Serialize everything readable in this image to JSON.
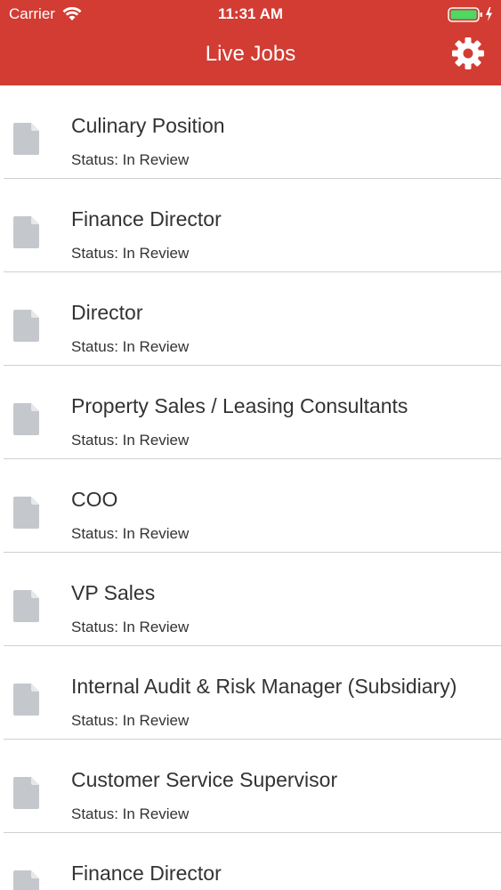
{
  "status_bar": {
    "carrier": "Carrier",
    "time": "11:31 AM",
    "battery_color": "#4cd964"
  },
  "nav": {
    "title": "Live Jobs",
    "settings_icon": "gear-icon",
    "background_color": "#d23c33"
  },
  "jobs": [
    {
      "title": "Culinary Position",
      "status": "Status: In Review"
    },
    {
      "title": "Finance Director",
      "status": "Status: In Review"
    },
    {
      "title": "Director",
      "status": "Status: In Review"
    },
    {
      "title": "Property Sales / Leasing Consultants",
      "status": "Status: In Review"
    },
    {
      "title": "COO",
      "status": "Status: In Review"
    },
    {
      "title": "VP Sales",
      "status": "Status: In Review"
    },
    {
      "title": "Internal Audit & Risk Manager (Subsidiary)",
      "status": "Status: In Review"
    },
    {
      "title": "Customer Service Supervisor",
      "status": "Status: In Review"
    },
    {
      "title": "Finance Director",
      "status": ""
    }
  ]
}
